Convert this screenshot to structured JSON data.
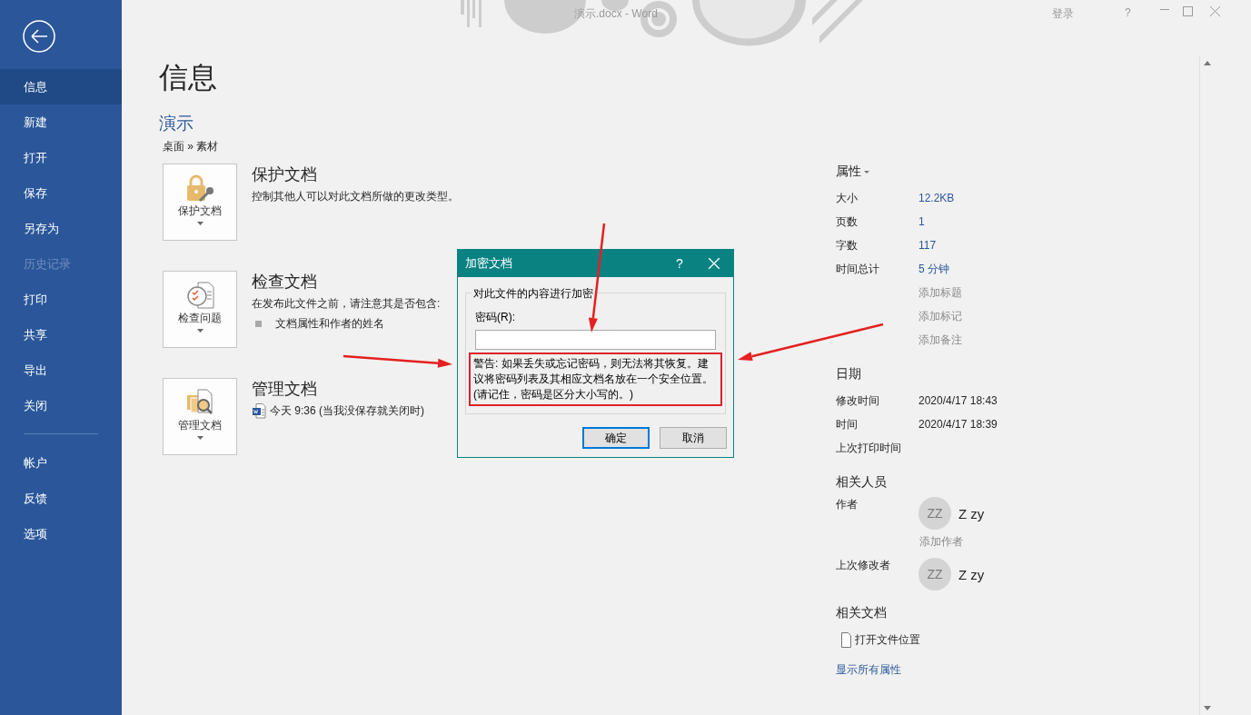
{
  "window": {
    "title": "演示.docx - Word",
    "sign_in": "登录",
    "help": "?"
  },
  "sidebar": {
    "items": [
      {
        "label": "信息",
        "selected": true,
        "disabled": false
      },
      {
        "label": "新建",
        "selected": false,
        "disabled": false
      },
      {
        "label": "打开",
        "selected": false,
        "disabled": false
      },
      {
        "label": "保存",
        "selected": false,
        "disabled": false
      },
      {
        "label": "另存为",
        "selected": false,
        "disabled": false
      },
      {
        "label": "历史记录",
        "selected": false,
        "disabled": true
      },
      {
        "label": "打印",
        "selected": false,
        "disabled": false
      },
      {
        "label": "共享",
        "selected": false,
        "disabled": false
      },
      {
        "label": "导出",
        "selected": false,
        "disabled": false
      },
      {
        "label": "关闭",
        "selected": false,
        "disabled": false
      }
    ],
    "bottom_items": [
      {
        "label": "帐户",
        "selected": false,
        "disabled": false
      },
      {
        "label": "反馈",
        "selected": false,
        "disabled": false
      },
      {
        "label": "选项",
        "selected": false,
        "disabled": false
      }
    ]
  },
  "page": {
    "title": "信息",
    "doc_name": "演示",
    "path": "桌面 » 素材"
  },
  "sections": [
    {
      "kind": "protect",
      "button": "保护文档",
      "heading": "保护文档",
      "description": "控制其他人可以对此文档所做的更改类型。"
    },
    {
      "kind": "inspect",
      "button": "检查问题",
      "heading": "检查文档",
      "description": "在发布此文件之前，请注意其是否包含:",
      "bullets": [
        "文档属性和作者的姓名"
      ]
    },
    {
      "kind": "manage",
      "button": "管理文档",
      "heading": "管理文档",
      "versions": [
        "今天 9:36 (当我没保存就关闭时)"
      ]
    }
  ],
  "properties": {
    "heading": "属性",
    "rows": [
      {
        "kind": "value",
        "label": "大小",
        "value": "12.2KB"
      },
      {
        "kind": "value",
        "label": "页数",
        "value": "1"
      },
      {
        "kind": "value",
        "label": "字数",
        "value": "117"
      },
      {
        "kind": "value",
        "label": "时间总计",
        "value": "5 分钟"
      },
      {
        "kind": "add",
        "placeholder": "添加标题"
      },
      {
        "kind": "add",
        "placeholder": "添加标记"
      },
      {
        "kind": "add",
        "placeholder": "添加备注"
      }
    ]
  },
  "dates": {
    "heading": "日期",
    "rows": [
      {
        "label": "修改时间",
        "value": "2020/4/17 18:43"
      },
      {
        "label": "时间",
        "value": "2020/4/17 18:39"
      },
      {
        "label": "上次打印时间"
      }
    ]
  },
  "people": {
    "heading": "相关人员",
    "rows": [
      {
        "label": "作者",
        "initials": "ZZ",
        "name": "Z zy",
        "add": "添加作者"
      },
      {
        "label": "上次修改者",
        "initials": "ZZ",
        "name": "Z zy"
      }
    ]
  },
  "related": {
    "heading": "相关文档",
    "items": [
      "打开文件位置"
    ],
    "link": "显示所有属性"
  },
  "dialog": {
    "title": "加密文档",
    "help": "?",
    "group_label": "对此文件的内容进行加密",
    "field_label": "密码(R):",
    "warning": "警告: 如果丢失或忘记密码，则无法将其恢复。建议将密码列表及其相应文档名放在一个安全位置。(请记住，密码是区分大小写的。)",
    "buttons": [
      {
        "label": "确定",
        "default": true
      },
      {
        "label": "取消",
        "default": false
      }
    ]
  }
}
